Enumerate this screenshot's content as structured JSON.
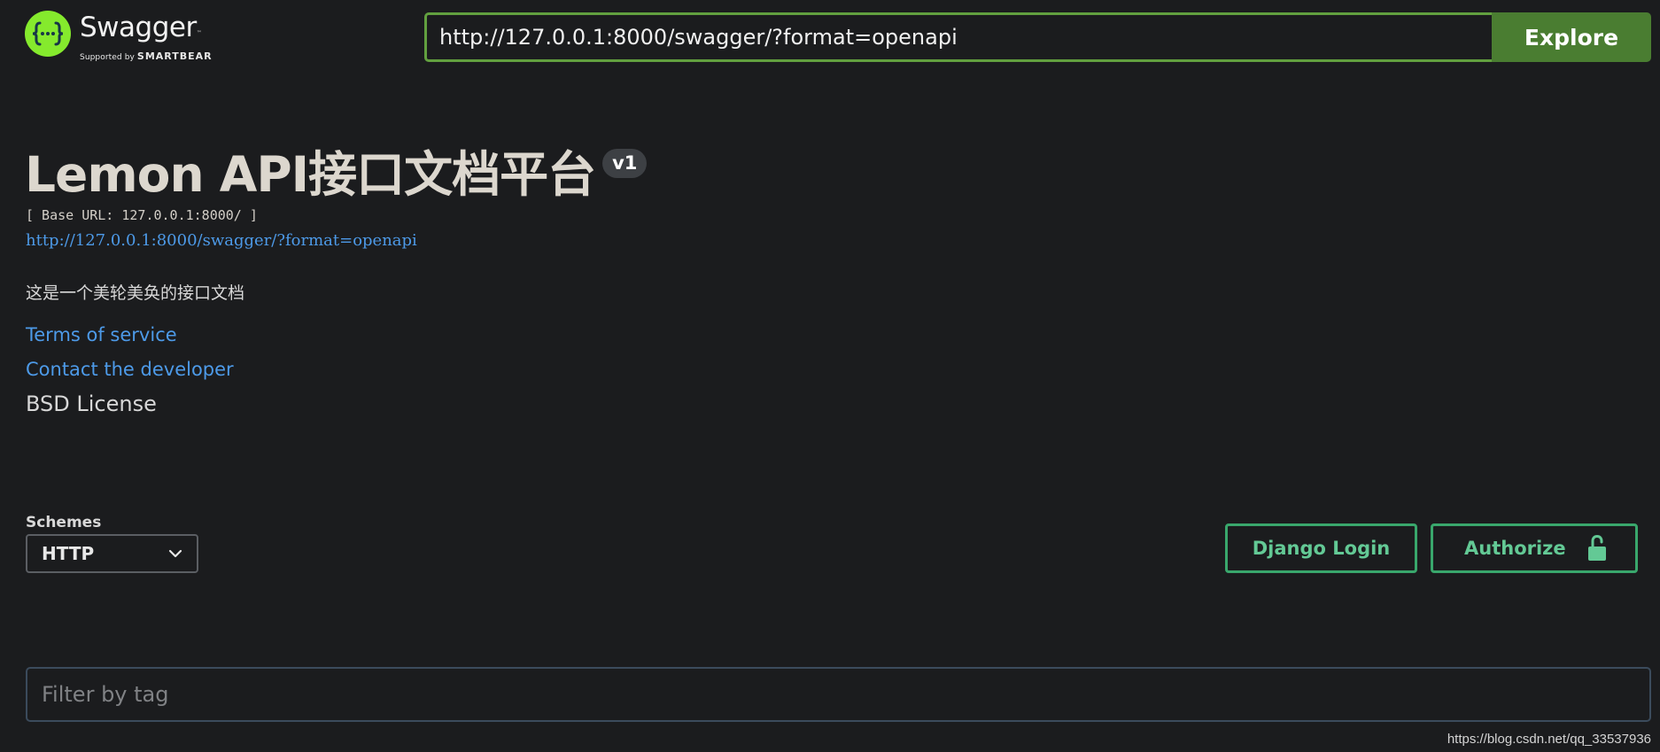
{
  "logo": {
    "title": "Swagger",
    "tm": "™",
    "supported_by": "Supported by",
    "brand": "SMARTBEAR",
    "brand_color": "#85ea2d"
  },
  "explore": {
    "url_value": "http://127.0.0.1:8000/swagger/?format=openapi",
    "button_label": "Explore",
    "accent_color": "#62a03f"
  },
  "info": {
    "title": "Lemon API接口文档平台",
    "version": "v1",
    "base_url": "[ Base URL: 127.0.0.1:8000/ ]",
    "spec_link": "http://127.0.0.1:8000/swagger/?format=openapi",
    "description": "这是一个美轮美奂的接口文档",
    "terms_link": "Terms of service",
    "contact_link": "Contact the developer",
    "license": "BSD License"
  },
  "schemes": {
    "label": "Schemes",
    "selected": "HTTP"
  },
  "auth": {
    "django_login_label": "Django Login",
    "authorize_label": "Authorize",
    "button_color": "#39a76c"
  },
  "filter": {
    "placeholder": "Filter by tag"
  },
  "watermark": "https://blog.csdn.net/qq_33537936",
  "icons": {
    "logo": "swagger-braces-icon",
    "select": "chevron-down-icon",
    "authorize": "unlocked-padlock-icon"
  }
}
